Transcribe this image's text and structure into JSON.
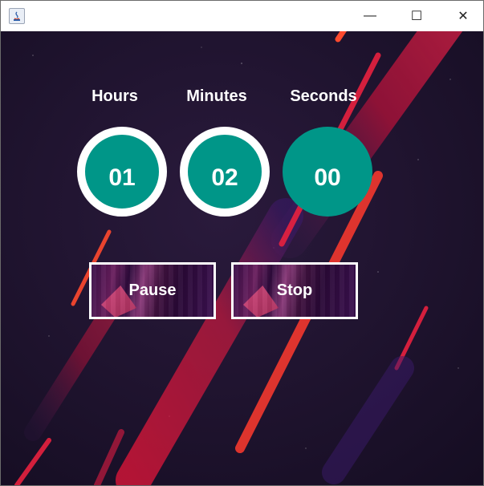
{
  "window": {
    "title": "",
    "controls": {
      "minimize": "—",
      "maximize": "☐",
      "close": "✕"
    }
  },
  "timer": {
    "hours_label": "Hours",
    "minutes_label": "Minutes",
    "seconds_label": "Seconds",
    "hours": "01",
    "minutes": "02",
    "seconds": "00"
  },
  "buttons": {
    "pause": "Pause",
    "stop": "Stop"
  },
  "colors": {
    "dial": "#009688",
    "ring": "#ffffff",
    "background": "#1e1530",
    "streak": "#e8213f"
  }
}
